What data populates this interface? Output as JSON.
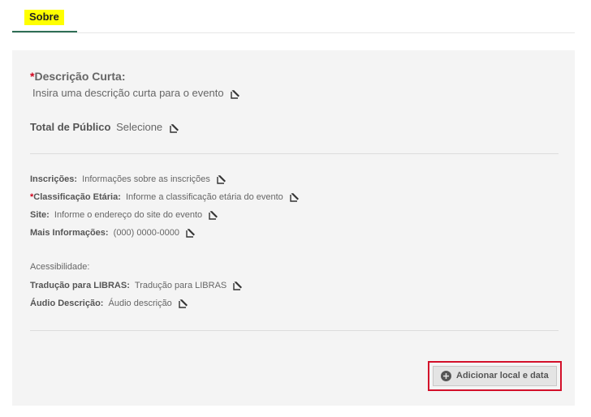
{
  "tabs": {
    "active_label": "Sobre"
  },
  "short_description": {
    "required_mark": "*",
    "label": "Descrição Curta:",
    "placeholder": "Insira uma descrição curta para o evento"
  },
  "audience": {
    "label": "Total de Público",
    "value": "Selecione"
  },
  "fields": [
    {
      "label": "Inscrições:",
      "value": "Informações sobre as inscrições",
      "required": false
    },
    {
      "label": "Classificação Etária:",
      "value": "Informe a classificação etária do evento",
      "required": true
    },
    {
      "label": "Site:",
      "value": "Informe o endereço do site do evento",
      "required": false
    },
    {
      "label": "Mais Informações:",
      "value": "(000) 0000-0000",
      "required": false
    }
  ],
  "accessibility": {
    "heading": "Acessibilidade:",
    "fields": [
      {
        "label": "Tradução para LIBRAS:",
        "value": "Tradução para LIBRAS"
      },
      {
        "label": "Áudio Descrição:",
        "value": "Áudio descrição"
      }
    ]
  },
  "add_button": {
    "label": "Adicionar local e data",
    "icon": "plus-circle-icon"
  },
  "icons": {
    "edit": "edit-icon"
  },
  "colors": {
    "tab_highlight": "#ffff00",
    "tab_underline": "#2f6f56",
    "required": "#d0021b",
    "button_outline": "#d3102a"
  }
}
